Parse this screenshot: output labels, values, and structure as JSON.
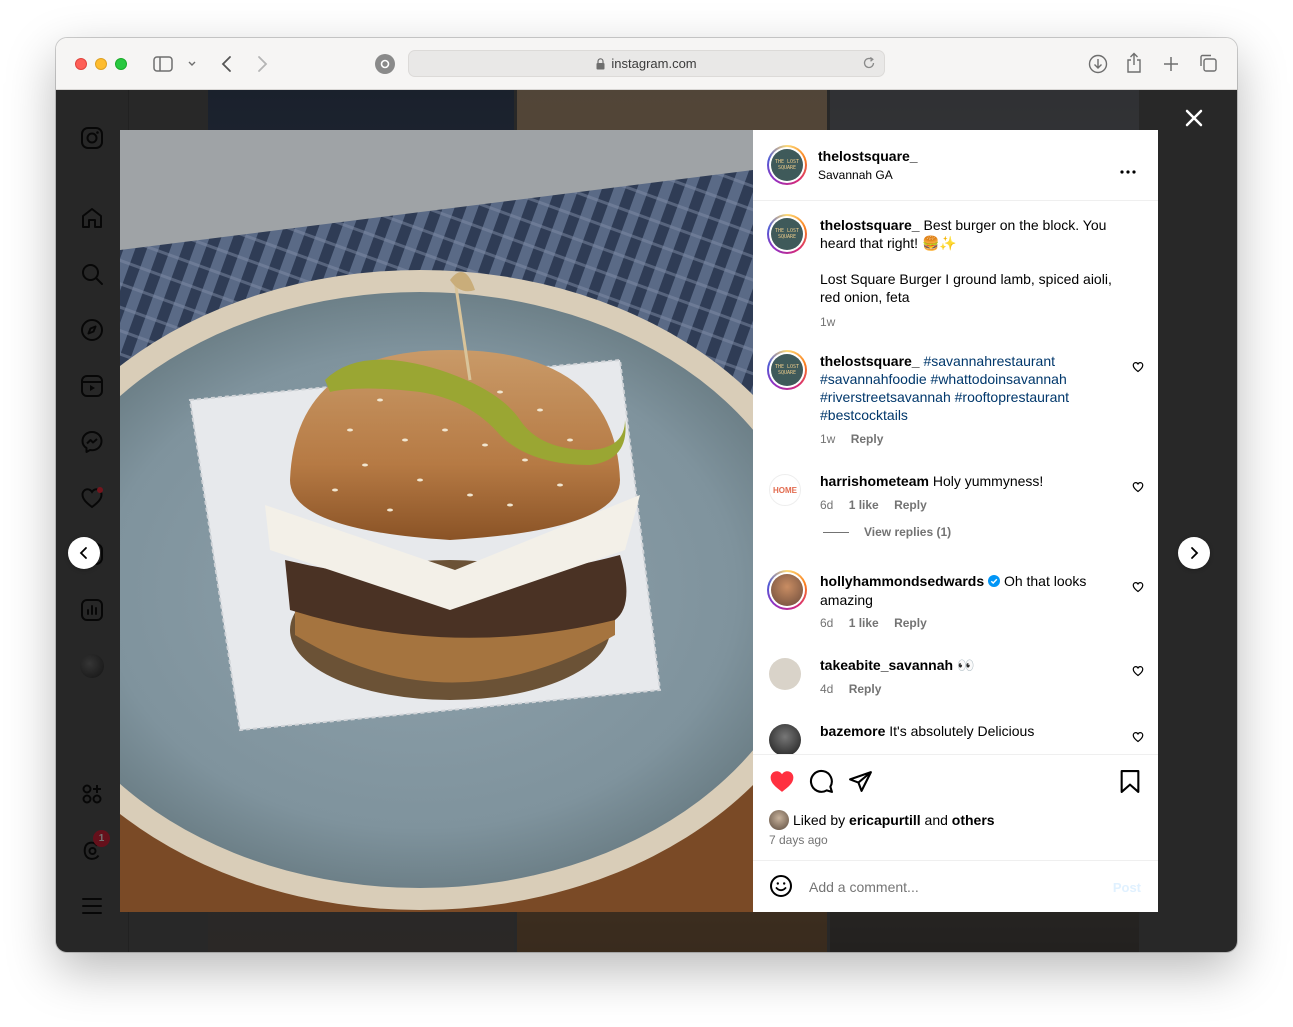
{
  "browser": {
    "url": "instagram.com"
  },
  "post": {
    "username": "thelostsquare_",
    "location": "Savannah GA",
    "avatar_text": "THE\nLOST\nSQUARE"
  },
  "caption": {
    "username": "thelostsquare_",
    "text": "Best burger on the block. You heard that right! 🍔✨",
    "text2": "Lost Square Burger I ground lamb, spiced aioli, red onion, feta",
    "time": "1w"
  },
  "comments": [
    {
      "username": "thelostsquare_",
      "text": "#savannahrestaurant #savannahfoodie #whattodoinsavannah #riverstreetsavannah #rooftoprestaurant #bestcocktails",
      "time": "1w",
      "likes": "",
      "reply": "Reply"
    },
    {
      "username": "harrishometeam",
      "text": "Holy yummyness!",
      "time": "6d",
      "likes": "1 like",
      "reply": "Reply",
      "view_replies": "View replies (1)",
      "avatar_text": "HOME"
    },
    {
      "username": "hollyhammondsedwards",
      "text": "Oh that looks amazing",
      "time": "6d",
      "likes": "1 like",
      "reply": "Reply"
    },
    {
      "username": "takeabite_savannah",
      "text": "👀",
      "time": "4d",
      "likes": "",
      "reply": "Reply"
    },
    {
      "username": "bazemore",
      "text": "It's absolutely Delicious",
      "time": "",
      "likes": "",
      "reply": ""
    }
  ],
  "likes": {
    "prefix": "Liked by",
    "user": "ericapurtill",
    "and": "and",
    "others": "others",
    "date": "7 days ago"
  },
  "add_comment": {
    "placeholder": "Add a comment...",
    "post": "Post"
  },
  "notifications": {
    "threads_badge": "1"
  },
  "colors": {
    "like_red": "#ff3040",
    "hashtag": "#00376b",
    "post_disabled": "#b3dbff",
    "verified": "#0095f6"
  }
}
